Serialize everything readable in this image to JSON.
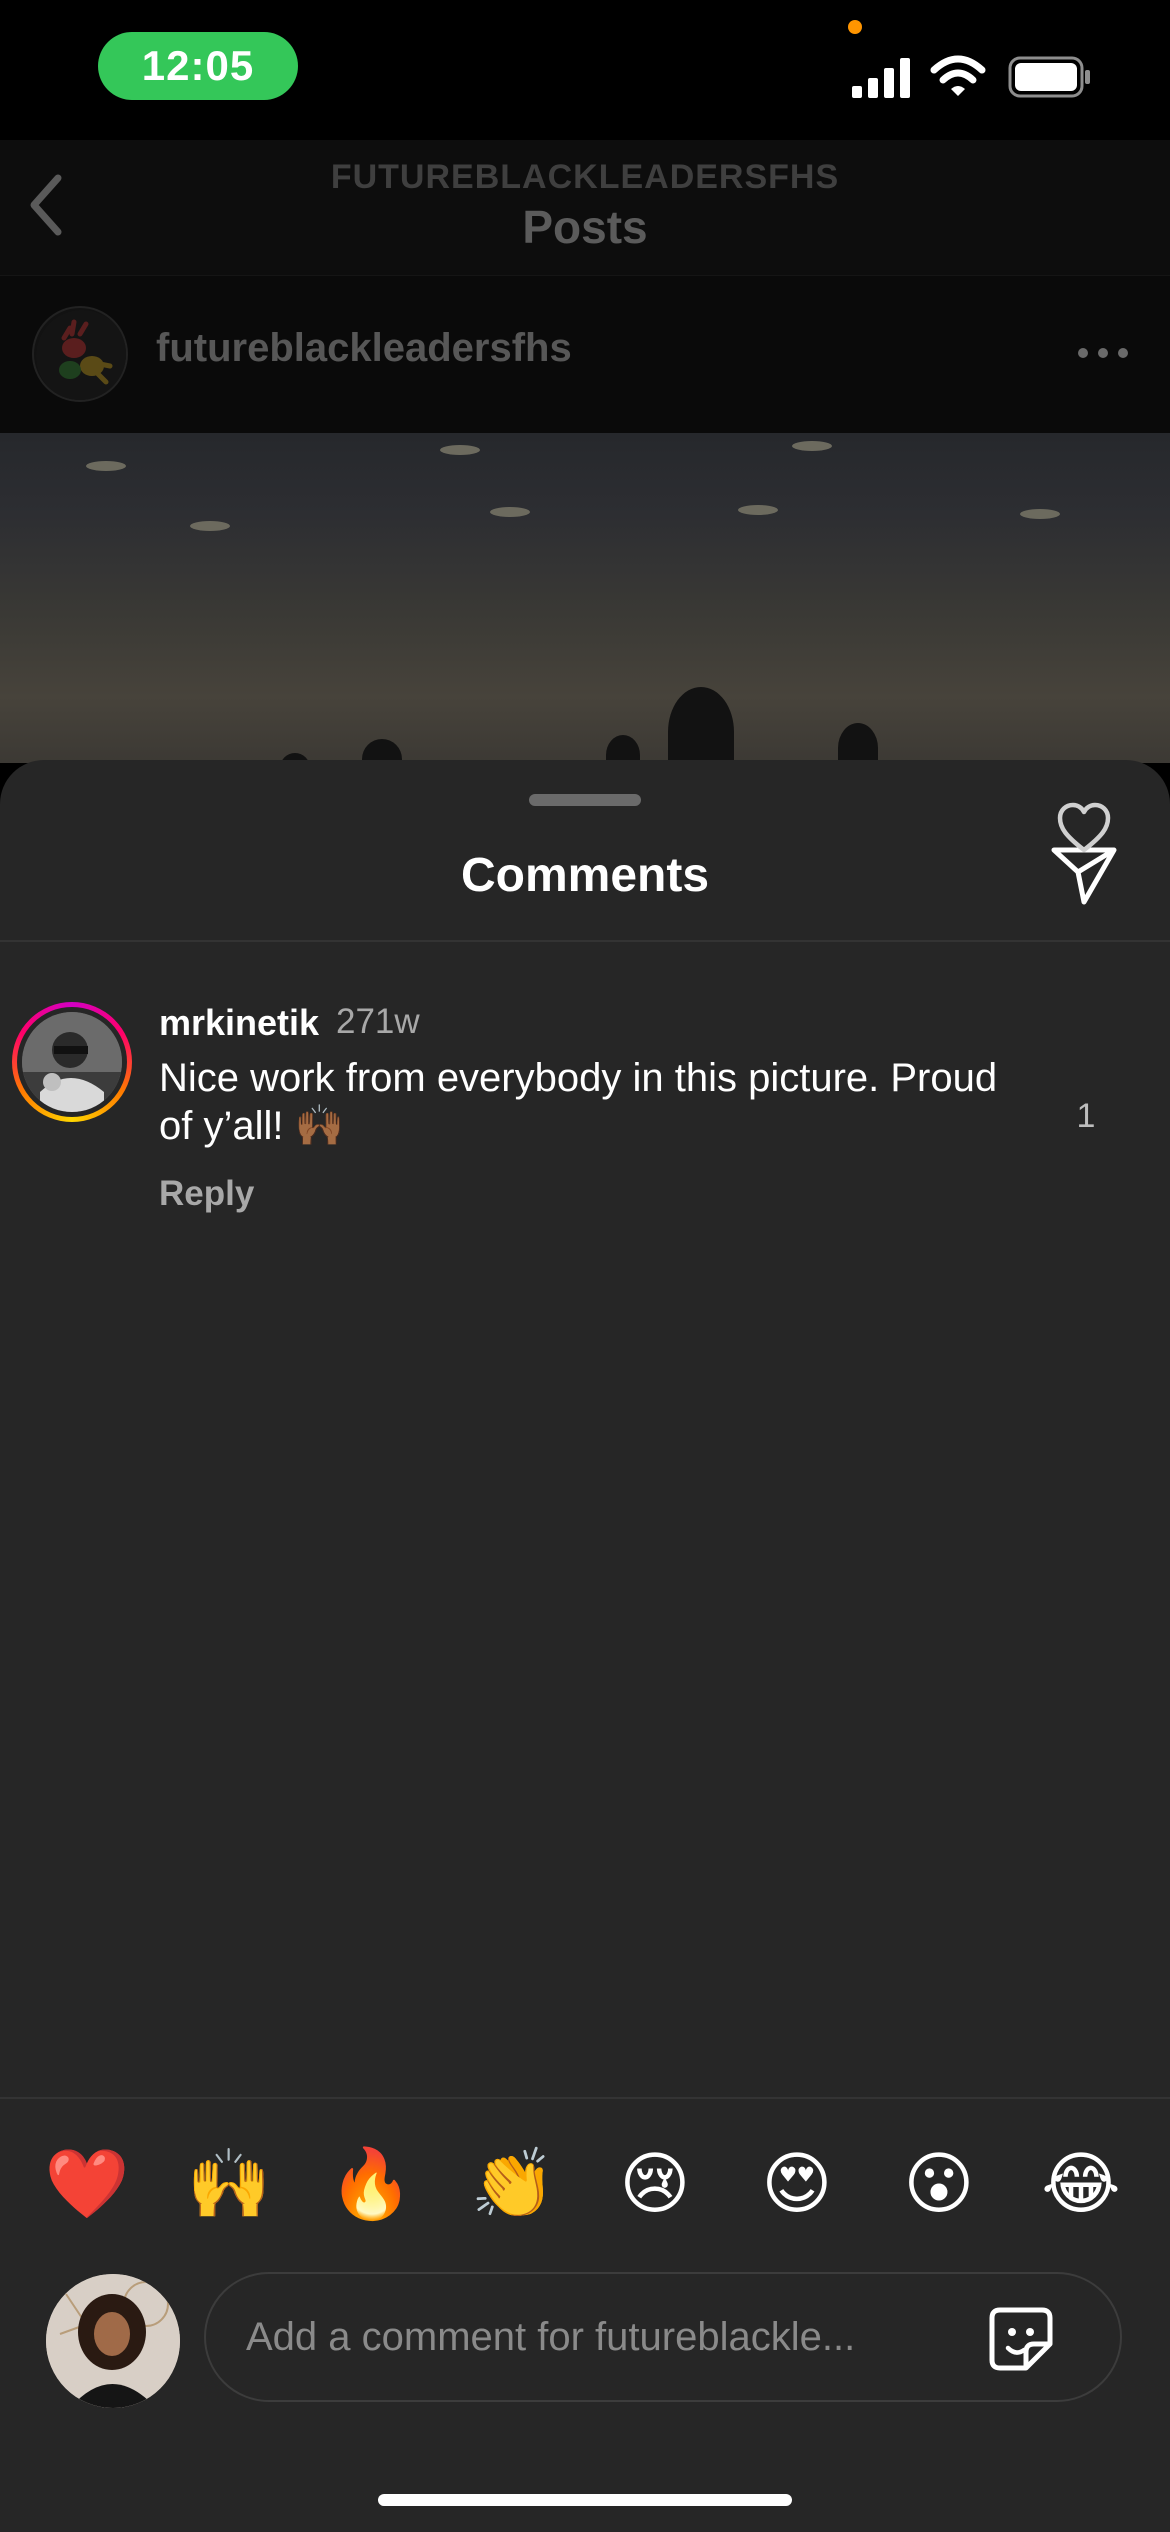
{
  "status_bar": {
    "time": "12:05",
    "time_pill_color": "#34c759",
    "icons": [
      "signal-icon",
      "wifi-icon",
      "battery-icon"
    ]
  },
  "background_post": {
    "header_account": "FUTUREBLACKLEADERSFHS",
    "header_title": "Posts",
    "username": "futureblackleadersfhs",
    "icons": [
      "back-chevron-icon",
      "more-options-icon"
    ]
  },
  "comments_sheet": {
    "title": "Comments",
    "comments": [
      {
        "username": "mrkinetik",
        "time": "271w",
        "text": "Nice work from everybody in this picture. Proud of y’all! 🙌🏾",
        "reply_label": "Reply",
        "like_count": "1"
      }
    ],
    "emoji_reactions": [
      "❤️",
      "🙌",
      "🔥",
      "👏",
      "😢",
      "😍",
      "😮",
      "😂"
    ],
    "composer": {
      "placeholder": "Add a comment for futureblackle..."
    }
  },
  "colors": {
    "sheet_background": "#262626",
    "secondary_text": "#a8a8a8",
    "story_ring": [
      "#d300c5",
      "#ff0069",
      "#ff7a00",
      "#ffd600"
    ]
  }
}
